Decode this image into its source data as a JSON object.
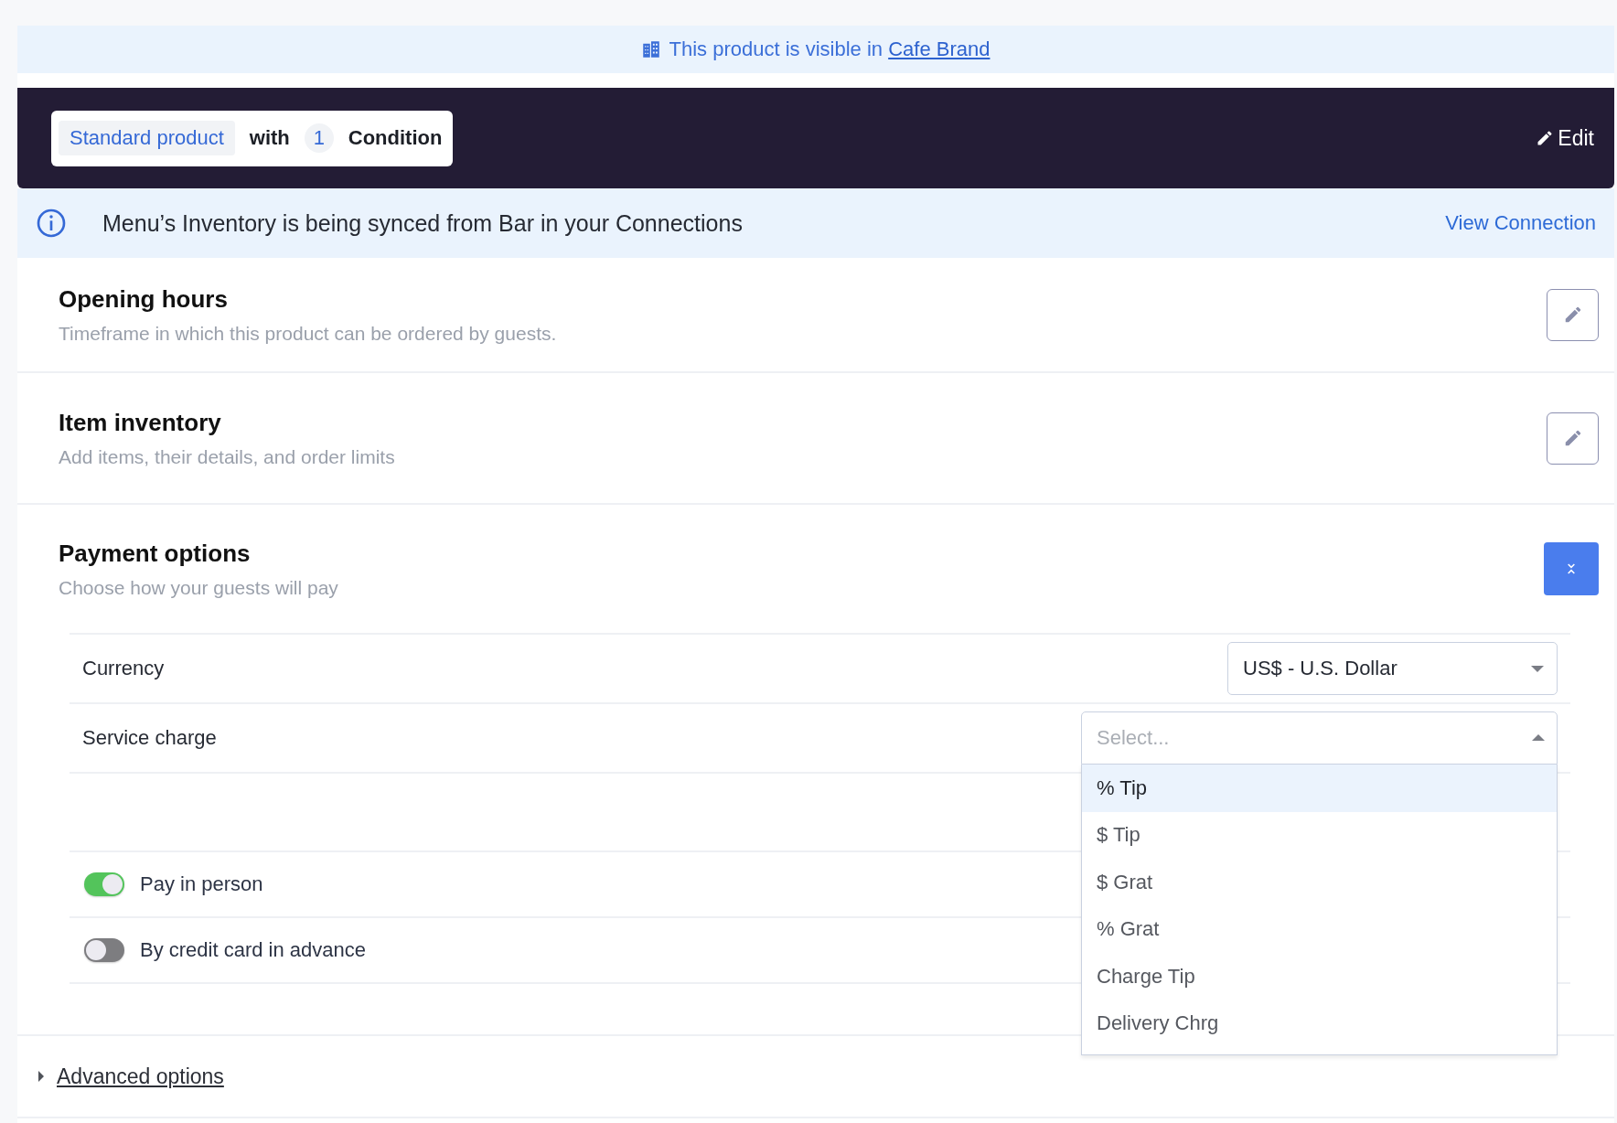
{
  "visibility_banner": {
    "text": "This product is visible in ",
    "link": "Cafe Brand"
  },
  "header": {
    "product_type": "Standard product",
    "joiner": "with",
    "condition_count": "1",
    "condition_label": "Condition",
    "edit_label": "Edit"
  },
  "sync_notice": {
    "text": "Menu’s Inventory is being synced from Bar in your Connections",
    "link": "View Connection"
  },
  "sections": [
    {
      "title": "Opening hours",
      "subtitle": "Timeframe in which this product can be ordered by guests.",
      "expanded": false
    },
    {
      "title": "Item inventory",
      "subtitle": "Add items, their details, and order limits",
      "expanded": false
    },
    {
      "title": "Payment options",
      "subtitle": "Choose how your guests will pay",
      "expanded": true,
      "payment": {
        "currency": {
          "label": "Currency",
          "value": "US$ - U.S. Dollar"
        },
        "service_charge": {
          "label": "Service charge",
          "placeholder": "Select...",
          "open": true,
          "options": [
            {
              "label": "% Tip",
              "selected": true
            },
            {
              "label": "$ Tip",
              "selected": false
            },
            {
              "label": "$ Grat",
              "selected": false
            },
            {
              "label": "% Grat",
              "selected": false
            },
            {
              "label": "Charge Tip",
              "selected": false
            },
            {
              "label": "Delivery Chrg",
              "selected": false
            }
          ]
        },
        "methods": [
          {
            "label": "Pay in person",
            "on": true
          },
          {
            "label": "By credit card in advance",
            "on": false
          }
        ]
      }
    }
  ],
  "advanced_options": {
    "label": "Advanced options",
    "expanded": false
  }
}
